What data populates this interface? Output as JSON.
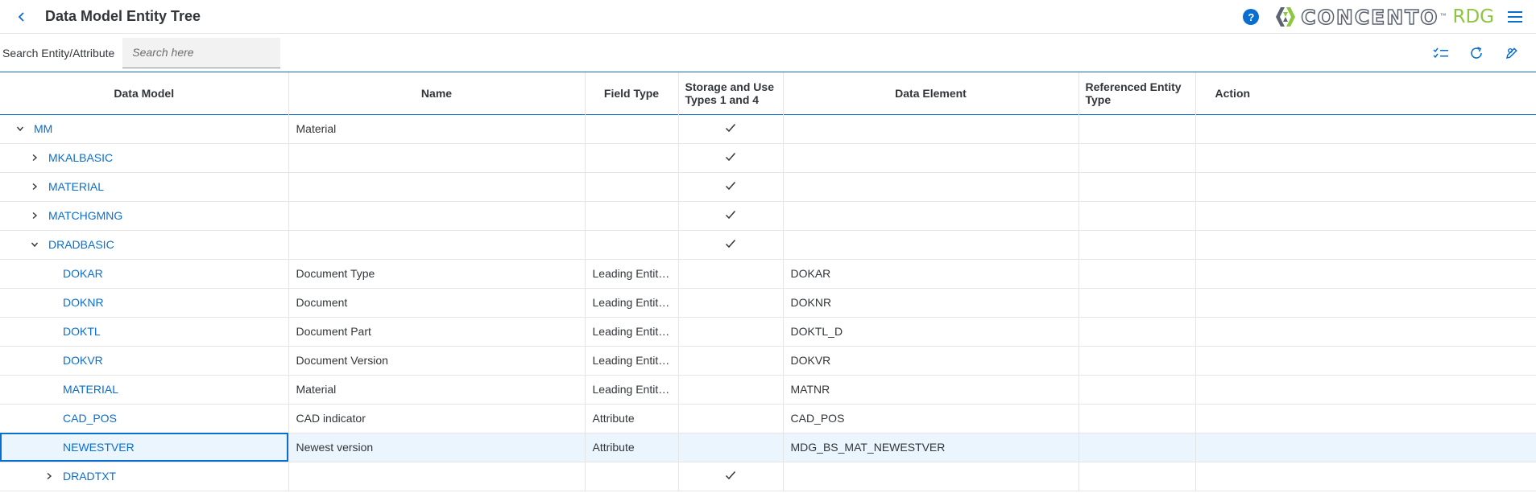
{
  "header": {
    "title": "Data Model Entity Tree",
    "logo_text": "CONCENTO",
    "logo_tm": "™",
    "logo_rdg": "RDG",
    "help_glyph": "?"
  },
  "toolbar": {
    "search_label": "Search Entity/Attribute",
    "search_placeholder": "Search here",
    "search_value": ""
  },
  "table": {
    "columns": [
      "Data Model",
      "Name",
      "Field Type",
      "Storage and Use Types 1 and 4",
      "Data Element",
      "Referenced Entity Type",
      "Action"
    ],
    "rows": [
      {
        "model": "MM",
        "level": 0,
        "expander": "expanded",
        "name": "Material",
        "field_type": "",
        "storage": true,
        "data_element": "",
        "ref_entity": "",
        "action": ""
      },
      {
        "model": "MKALBASIC",
        "level": 1,
        "expander": "collapsed",
        "name": "",
        "field_type": "",
        "storage": true,
        "data_element": "",
        "ref_entity": "",
        "action": ""
      },
      {
        "model": "MATERIAL",
        "level": 1,
        "expander": "collapsed",
        "name": "",
        "field_type": "",
        "storage": true,
        "data_element": "",
        "ref_entity": "",
        "action": ""
      },
      {
        "model": "MATCHGMNG",
        "level": 1,
        "expander": "collapsed",
        "name": "",
        "field_type": "",
        "storage": true,
        "data_element": "",
        "ref_entity": "",
        "action": ""
      },
      {
        "model": "DRADBASIC",
        "level": 1,
        "expander": "expanded",
        "name": "",
        "field_type": "",
        "storage": true,
        "data_element": "",
        "ref_entity": "",
        "action": ""
      },
      {
        "model": "DOKAR",
        "level": 2,
        "expander": "none",
        "name": "Document Type",
        "field_type": "Leading Entity Type",
        "storage": false,
        "data_element": "DOKAR",
        "ref_entity": "",
        "action": ""
      },
      {
        "model": "DOKNR",
        "level": 2,
        "expander": "none",
        "name": "Document",
        "field_type": "Leading Entity Type",
        "storage": false,
        "data_element": "DOKNR",
        "ref_entity": "",
        "action": ""
      },
      {
        "model": "DOKTL",
        "level": 2,
        "expander": "none",
        "name": "Document Part",
        "field_type": "Leading Entity Type",
        "storage": false,
        "data_element": "DOKTL_D",
        "ref_entity": "",
        "action": ""
      },
      {
        "model": "DOKVR",
        "level": 2,
        "expander": "none",
        "name": "Document Version",
        "field_type": "Leading Entity Type",
        "storage": false,
        "data_element": "DOKVR",
        "ref_entity": "",
        "action": ""
      },
      {
        "model": "MATERIAL",
        "level": 2,
        "expander": "none",
        "name": "Material",
        "field_type": "Leading Entity Type",
        "storage": false,
        "data_element": "MATNR",
        "ref_entity": "",
        "action": ""
      },
      {
        "model": "CAD_POS",
        "level": 2,
        "expander": "none",
        "name": "CAD indicator",
        "field_type": "Attribute",
        "storage": false,
        "data_element": "CAD_POS",
        "ref_entity": "",
        "action": ""
      },
      {
        "model": "NEWESTVER",
        "level": 2,
        "expander": "none",
        "name": "Newest version",
        "field_type": "Attribute",
        "storage": false,
        "data_element": "MDG_BS_MAT_NEWESTVER",
        "ref_entity": "",
        "action": "",
        "selected": true
      },
      {
        "model": "DRADTXT",
        "level": 2,
        "expander": "collapsed",
        "name": "",
        "field_type": "",
        "storage": true,
        "data_element": "",
        "ref_entity": "",
        "action": ""
      }
    ]
  },
  "icons": {
    "back": "chevron-left-icon",
    "help": "help-icon",
    "menu": "hamburger-menu-icon",
    "multi_select": "multi-select-icon",
    "refresh": "refresh-icon",
    "edit": "edit-icon",
    "check": "checkmark-icon"
  },
  "colors": {
    "accent": "#0a6ed1",
    "logo_green": "#8dc63f",
    "logo_gray": "#5b6470",
    "selected_row": "#ebf5fe"
  }
}
